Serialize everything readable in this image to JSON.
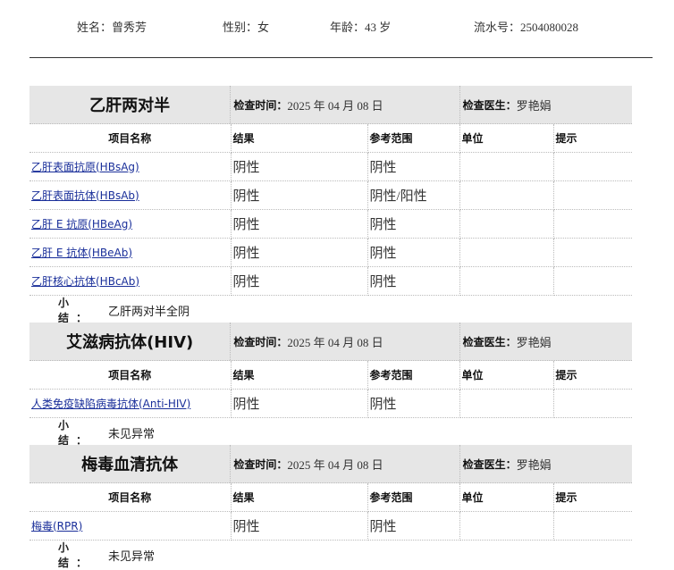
{
  "patient": {
    "name": "姓名：曾秀芳",
    "gender": "性别：女",
    "age": "年龄：43 岁",
    "serial": "流水号：2504080028"
  },
  "labels": {
    "exam_time": "检查时间：",
    "doctor": "检查医生：",
    "summary": "小结：",
    "columns": [
      "项目名称",
      "结果",
      "参考范围",
      "单位",
      "提示"
    ]
  },
  "sections": [
    {
      "title": "乙肝两对半",
      "exam_time": "2025 年 04 月 08 日",
      "doctor": "罗艳娟",
      "rows": [
        {
          "name": "乙肝表面抗原(HBsAg)",
          "result": "阴性",
          "range": "阴性",
          "unit": "",
          "hint": ""
        },
        {
          "name": "乙肝表面抗体(HBsAb)",
          "result": "阴性",
          "range": "阴性/阳性",
          "unit": "",
          "hint": ""
        },
        {
          "name": "乙肝 E 抗原(HBeAg)",
          "result": "阴性",
          "range": "阴性",
          "unit": "",
          "hint": ""
        },
        {
          "name": "乙肝 E 抗体(HBeAb)",
          "result": "阴性",
          "range": "阴性",
          "unit": "",
          "hint": ""
        },
        {
          "name": "乙肝核心抗体(HBcAb)",
          "result": "阴性",
          "range": "阴性",
          "unit": "",
          "hint": ""
        }
      ],
      "summary": "乙肝两对半全阴"
    },
    {
      "title": "艾滋病抗体(HIV)",
      "exam_time": "2025 年 04 月 08 日",
      "doctor": "罗艳娟",
      "rows": [
        {
          "name": "人类免疫缺陷病毒抗体(Anti-HIV)",
          "result": "阴性",
          "range": "阴性",
          "unit": "",
          "hint": ""
        }
      ],
      "summary": "未见异常"
    },
    {
      "title": "梅毒血清抗体",
      "exam_time": "2025 年 04 月 08 日",
      "doctor": "罗艳娟",
      "rows": [
        {
          "name": "梅毒(RPR)",
          "result": "阴性",
          "range": "阴性",
          "unit": "",
          "hint": ""
        }
      ],
      "summary": "未见异常"
    }
  ]
}
